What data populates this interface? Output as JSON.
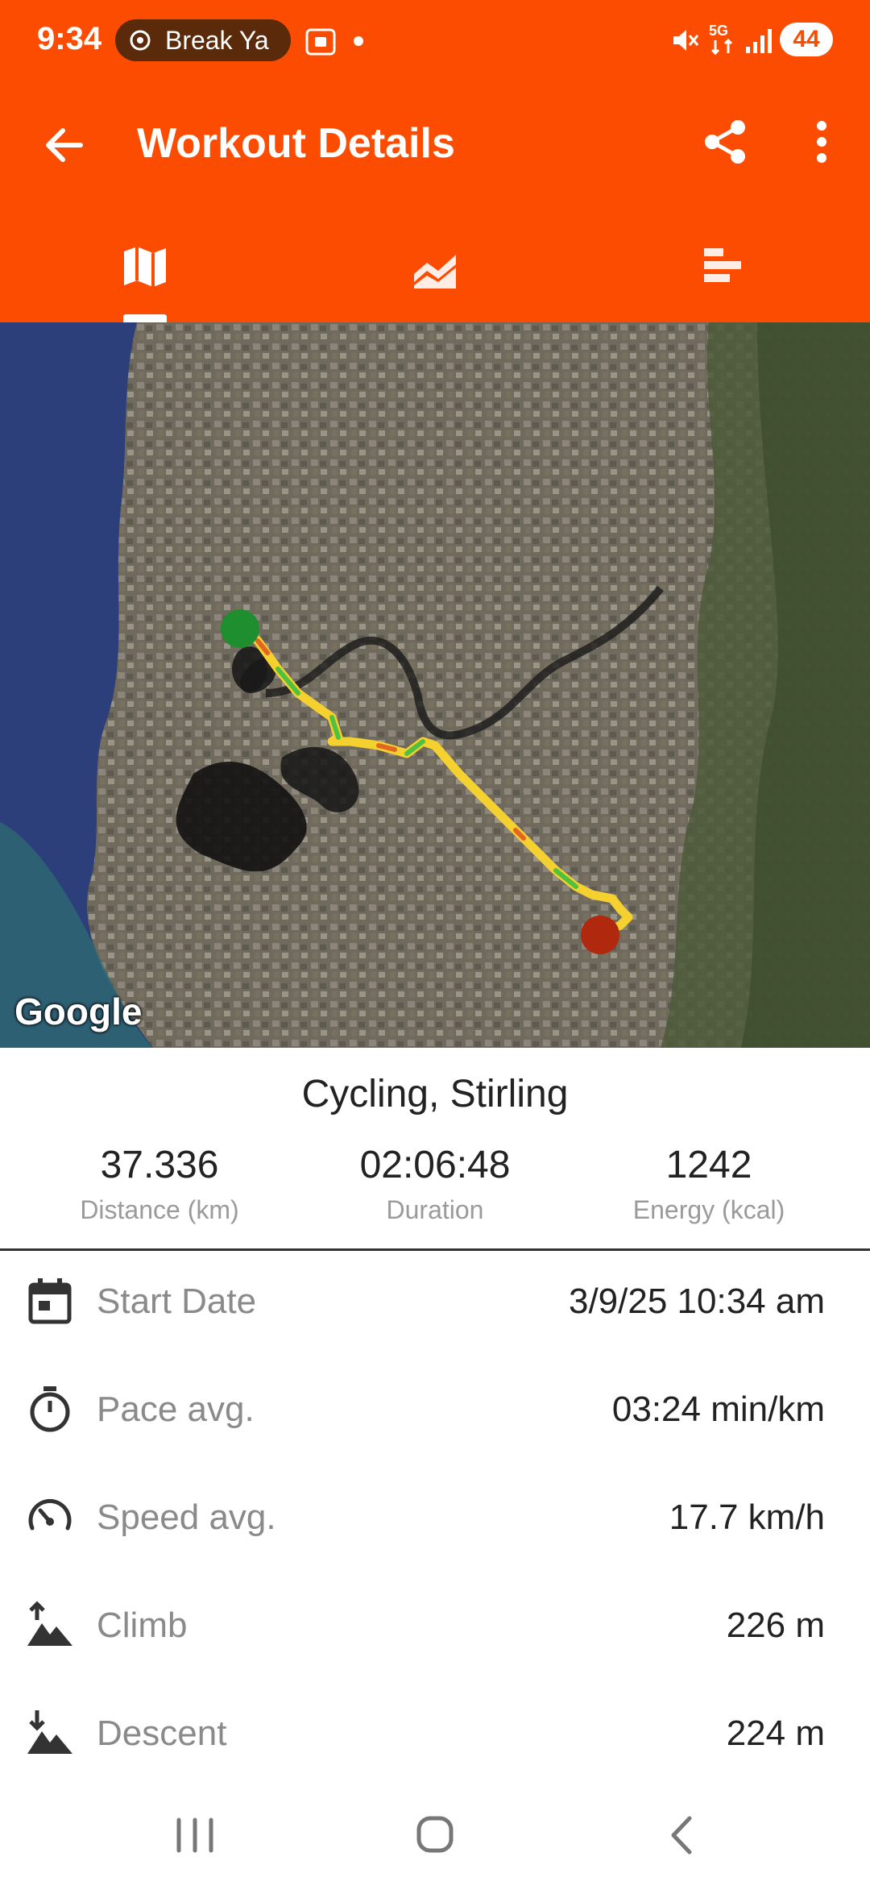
{
  "status_bar": {
    "time": "9:34",
    "media_pill": "Break Ya",
    "battery": "44",
    "icons": [
      "screenshot-icon",
      "dot-icon",
      "mute-icon",
      "5g-icon",
      "signal-icon",
      "battery-icon"
    ]
  },
  "toolbar": {
    "title": "Workout Details",
    "back_icon": "arrow-left-icon",
    "share_icon": "share-icon",
    "more_icon": "more-vert-icon"
  },
  "tabs": [
    {
      "icon": "map-icon",
      "selected": true
    },
    {
      "icon": "area-chart-icon",
      "selected": false
    },
    {
      "icon": "bar-list-icon",
      "selected": false
    }
  ],
  "map": {
    "attribution": "Google"
  },
  "summary": {
    "activity": "Cycling, Stirling",
    "stats": [
      {
        "value": "37.336",
        "label": "Distance (km)"
      },
      {
        "value": "02:06:48",
        "label": "Duration"
      },
      {
        "value": "1242",
        "label": "Energy (kcal)"
      }
    ]
  },
  "details": [
    {
      "icon": "calendar-icon",
      "label": "Start Date",
      "value": "3/9/25 10:34 am"
    },
    {
      "icon": "stopwatch-icon",
      "label": "Pace avg.",
      "value": "03:24 min/km"
    },
    {
      "icon": "speedometer-icon",
      "label": "Speed avg.",
      "value": "17.7 km/h"
    },
    {
      "icon": "climb-icon",
      "label": "Climb",
      "value": "226 m"
    },
    {
      "icon": "descent-icon",
      "label": "Descent",
      "value": "224 m"
    }
  ],
  "colors": {
    "brand": "#FC4C02",
    "route": "#F5D12F",
    "start_marker": "#1E8E2E",
    "end_marker": "#B0280E"
  }
}
